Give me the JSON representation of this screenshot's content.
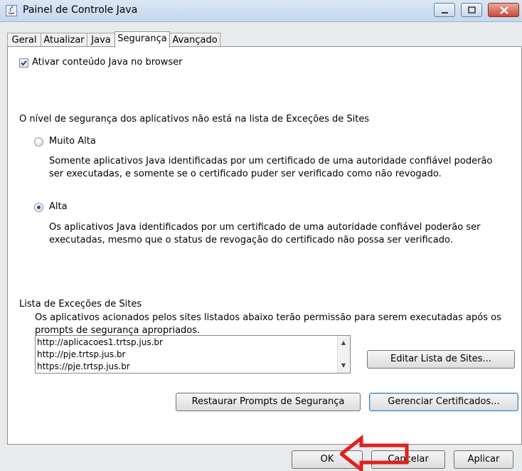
{
  "window": {
    "title": "Painel de Controle Java"
  },
  "tabs": [
    "Geral",
    "Atualizar",
    "Java",
    "Segurança",
    "Avançado"
  ],
  "active_tab": "Segurança",
  "security": {
    "enable_checkbox_label": "Ativar conteúdo Java no browser",
    "enable_checked": true,
    "level_heading": "O nível de segurança dos aplicativos não está na lista de Exceções de Sites",
    "levels": [
      {
        "label": "Muito Alta",
        "selected": false,
        "description_line1": "Somente aplicativos Java identificadas por um certificado de uma autoridade confiável poderão",
        "description_line2": "ser executadas, e somente se o certificado puder ser verificado como não revogado."
      },
      {
        "label": "Alta",
        "selected": true,
        "description_line1": "Os aplicativos Java identificados por um certificado de uma autoridade confiável poderão ser",
        "description_line2": "executadas, mesmo que o status de revogação do certificado não possa ser verificado."
      }
    ],
    "exceptions": {
      "heading": "Lista de Exceções de Sites",
      "description_line1": "Os aplicativos acionados pelos sites listados abaixo terão permissão para serem executadas após os",
      "description_line2": "prompts de segurança apropriados.",
      "sites": [
        "http://aplicacoes1.trtsp.jus.br",
        "http://pje.trtsp.jus.br",
        "https://pje.trtsp.jus.br"
      ],
      "edit_button": "Editar Lista de Sites..."
    },
    "restore_button": "Restaurar Prompts de Segurança",
    "manage_certs_button": "Gerenciar Certificados..."
  },
  "footer": {
    "ok": "OK",
    "cancel": "Cancelar",
    "apply": "Aplicar"
  },
  "annotation": {
    "arrow_color": "#e02020"
  }
}
